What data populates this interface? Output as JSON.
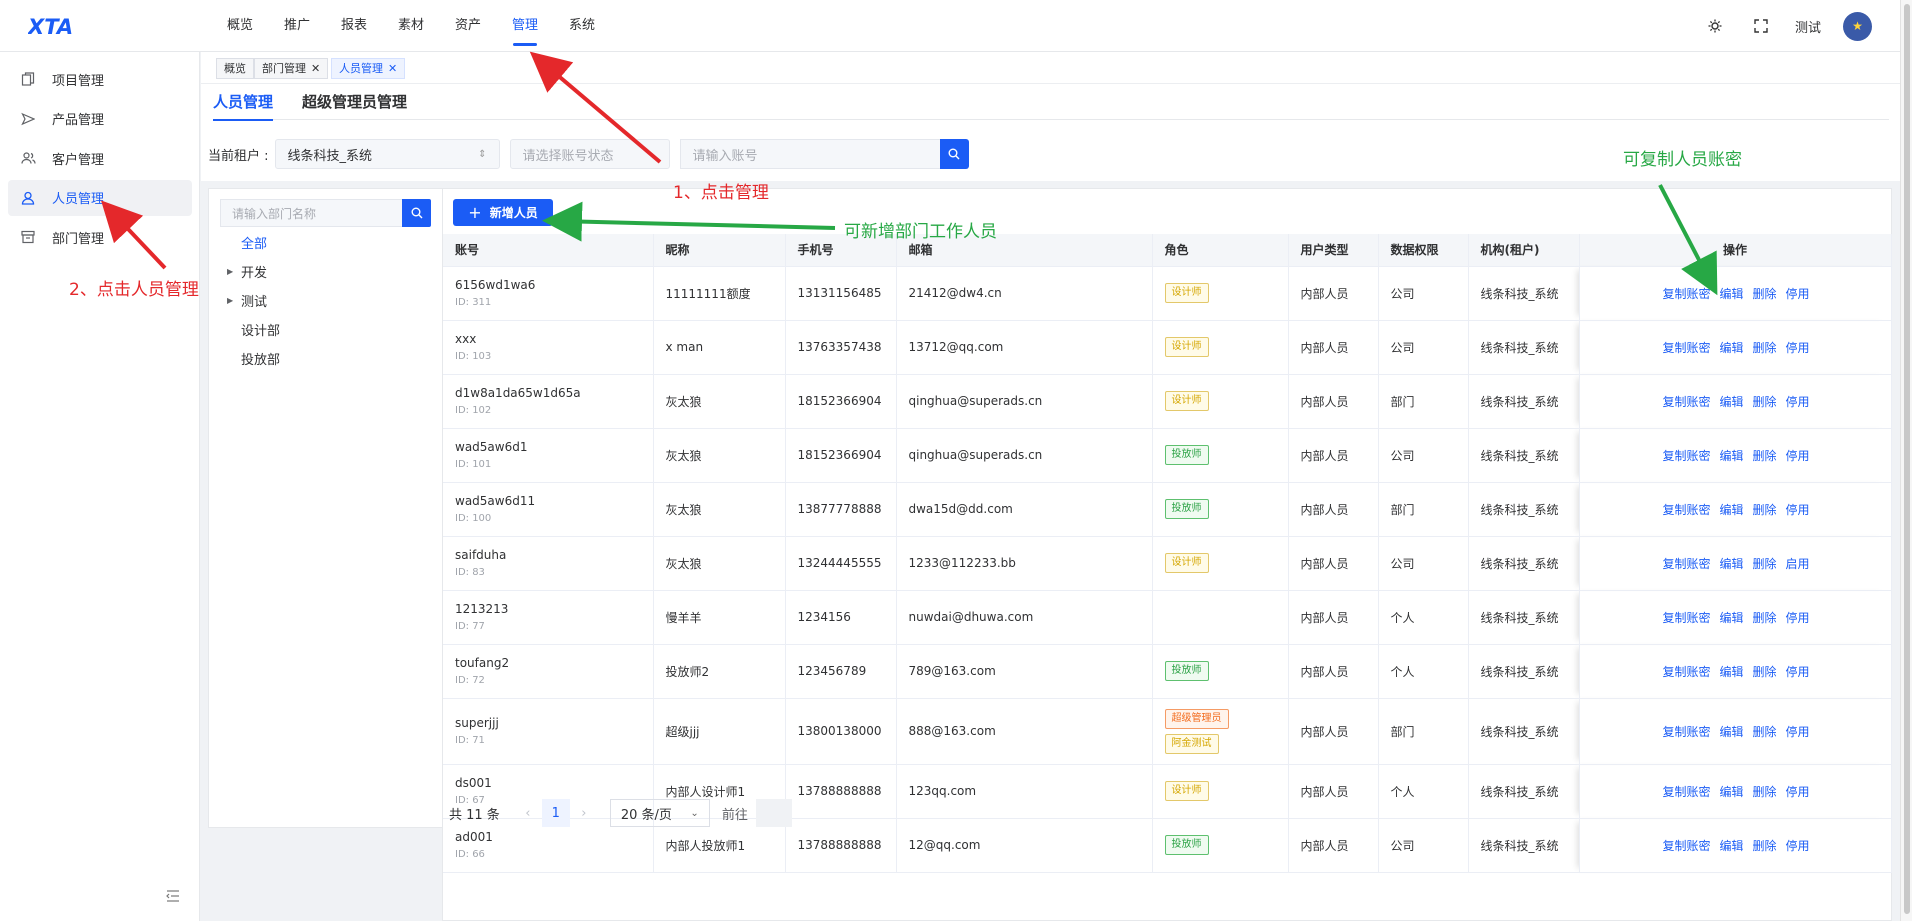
{
  "logo": "XTA",
  "topnav": [
    "概览",
    "推广",
    "报表",
    "素材",
    "资产",
    "管理",
    "系统"
  ],
  "topnav_active": "管理",
  "user": {
    "name": "测试"
  },
  "sidebar": {
    "items": [
      {
        "label": "项目管理",
        "icon": "project-icon"
      },
      {
        "label": "产品管理",
        "icon": "product-icon"
      },
      {
        "label": "客户管理",
        "icon": "customer-icon"
      },
      {
        "label": "人员管理",
        "icon": "person-icon"
      },
      {
        "label": "部门管理",
        "icon": "department-icon"
      }
    ],
    "active": "人员管理"
  },
  "tabs": [
    {
      "label": "概览",
      "closable": false
    },
    {
      "label": "部门管理",
      "closable": true
    },
    {
      "label": "人员管理",
      "closable": true
    }
  ],
  "subtabs": [
    "人员管理",
    "超级管理员管理"
  ],
  "filters": {
    "tenant_label": "当前租户 :",
    "tenant_value": "线条科技_系统",
    "status_placeholder": "请选择账号状态",
    "account_placeholder": "请输入账号"
  },
  "dept_panel": {
    "search_placeholder": "请输入部门名称",
    "tree": [
      {
        "label": "全部",
        "expandable": false
      },
      {
        "label": "开发",
        "expandable": true
      },
      {
        "label": "测试",
        "expandable": true
      },
      {
        "label": "设计部",
        "expandable": false
      },
      {
        "label": "投放部",
        "expandable": false
      }
    ]
  },
  "table": {
    "add_button": "新增人员",
    "columns": [
      "账号",
      "昵称",
      "手机号",
      "邮箱",
      "角色",
      "用户类型",
      "数据权限",
      "机构(租户)",
      "操作"
    ],
    "rows": [
      {
        "account": "6156wd1wa6",
        "id": "ID: 311",
        "nickname": "11111111额度",
        "phone": "13131156485",
        "email": "21412@dw4.cn",
        "roles": [
          {
            "text": "设计师",
            "color": "yellow"
          }
        ],
        "user_type": "内部人员",
        "scope": "公司",
        "org": "线条科技_系统",
        "ops": [
          "复制账密",
          "编辑",
          "删除",
          "停用"
        ]
      },
      {
        "account": "xxx",
        "id": "ID: 103",
        "nickname": "x man",
        "phone": "13763357438",
        "email": "13712@qq.com",
        "roles": [
          {
            "text": "设计师",
            "color": "yellow"
          }
        ],
        "user_type": "内部人员",
        "scope": "公司",
        "org": "线条科技_系统",
        "ops": [
          "复制账密",
          "编辑",
          "删除",
          "停用"
        ]
      },
      {
        "account": "d1w8a1da65w1d65a",
        "id": "ID: 102",
        "nickname": "灰太狼",
        "phone": "18152366904",
        "email": "qinghua@superads.cn",
        "roles": [
          {
            "text": "设计师",
            "color": "yellow"
          }
        ],
        "user_type": "内部人员",
        "scope": "部门",
        "org": "线条科技_系统",
        "ops": [
          "复制账密",
          "编辑",
          "删除",
          "停用"
        ]
      },
      {
        "account": "wad5aw6d1",
        "id": "ID: 101",
        "nickname": "灰太狼",
        "phone": "18152366904",
        "email": "qinghua@superads.cn",
        "roles": [
          {
            "text": "投放师",
            "color": "green"
          }
        ],
        "user_type": "内部人员",
        "scope": "公司",
        "org": "线条科技_系统",
        "ops": [
          "复制账密",
          "编辑",
          "删除",
          "停用"
        ]
      },
      {
        "account": "wad5aw6d11",
        "id": "ID: 100",
        "nickname": "灰太狼",
        "phone": "13877778888",
        "email": "dwa15d@dd.com",
        "roles": [
          {
            "text": "投放师",
            "color": "green"
          }
        ],
        "user_type": "内部人员",
        "scope": "部门",
        "org": "线条科技_系统",
        "ops": [
          "复制账密",
          "编辑",
          "删除",
          "停用"
        ]
      },
      {
        "account": "saifduha",
        "id": "ID: 83",
        "nickname": "灰太狼",
        "phone": "13244445555",
        "email": "1233@112233.bb",
        "roles": [
          {
            "text": "设计师",
            "color": "yellow"
          }
        ],
        "user_type": "内部人员",
        "scope": "公司",
        "org": "线条科技_系统",
        "ops": [
          "复制账密",
          "编辑",
          "删除",
          "启用"
        ]
      },
      {
        "account": "1213213",
        "id": "ID: 77",
        "nickname": "慢羊羊",
        "phone": "1234156",
        "email": "nuwdai@dhuwa.com",
        "roles": [],
        "user_type": "内部人员",
        "scope": "个人",
        "org": "线条科技_系统",
        "ops": [
          "复制账密",
          "编辑",
          "删除",
          "停用"
        ]
      },
      {
        "account": "toufang2",
        "id": "ID: 72",
        "nickname": "投放师2",
        "phone": "123456789",
        "email": "789@163.com",
        "roles": [
          {
            "text": "投放师",
            "color": "green"
          }
        ],
        "user_type": "内部人员",
        "scope": "个人",
        "org": "线条科技_系统",
        "ops": [
          "复制账密",
          "编辑",
          "删除",
          "停用"
        ]
      },
      {
        "account": "superjjj",
        "id": "ID: 71",
        "nickname": "超级jjj",
        "phone": "13800138000",
        "email": "888@163.com",
        "roles": [
          {
            "text": "超级管理员",
            "color": "orange"
          },
          {
            "text": "阿金测试",
            "color": "yellow"
          }
        ],
        "user_type": "内部人员",
        "scope": "部门",
        "org": "线条科技_系统",
        "ops": [
          "复制账密",
          "编辑",
          "删除",
          "停用"
        ]
      },
      {
        "account": "ds001",
        "id": "ID: 67",
        "nickname": "内部人设计师1",
        "phone": "13788888888",
        "email": "123qq.com",
        "roles": [
          {
            "text": "设计师",
            "color": "yellow"
          }
        ],
        "user_type": "内部人员",
        "scope": "个人",
        "org": "线条科技_系统",
        "ops": [
          "复制账密",
          "编辑",
          "删除",
          "停用"
        ]
      },
      {
        "account": "ad001",
        "id": "ID: 66",
        "nickname": "内部人投放师1",
        "phone": "13788888888",
        "email": "12@qq.com",
        "roles": [
          {
            "text": "投放师",
            "color": "green"
          }
        ],
        "user_type": "内部人员",
        "scope": "公司",
        "org": "线条科技_系统",
        "ops": [
          "复制账密",
          "编辑",
          "删除",
          "停用"
        ]
      }
    ]
  },
  "pagination": {
    "total": "共 11 条",
    "current": "1",
    "page_size": "20 条/页",
    "goto": "前往"
  },
  "annotations": {
    "click_manage": "1、点击管理",
    "click_people": "2、点击人员管理",
    "add_staff": "可新增部门工作人员",
    "copy_credentials": "可复制人员账密"
  },
  "colors": {
    "accent": "#1b5cf5",
    "annotation_red": "#e4282b",
    "annotation_green": "#27a845"
  }
}
